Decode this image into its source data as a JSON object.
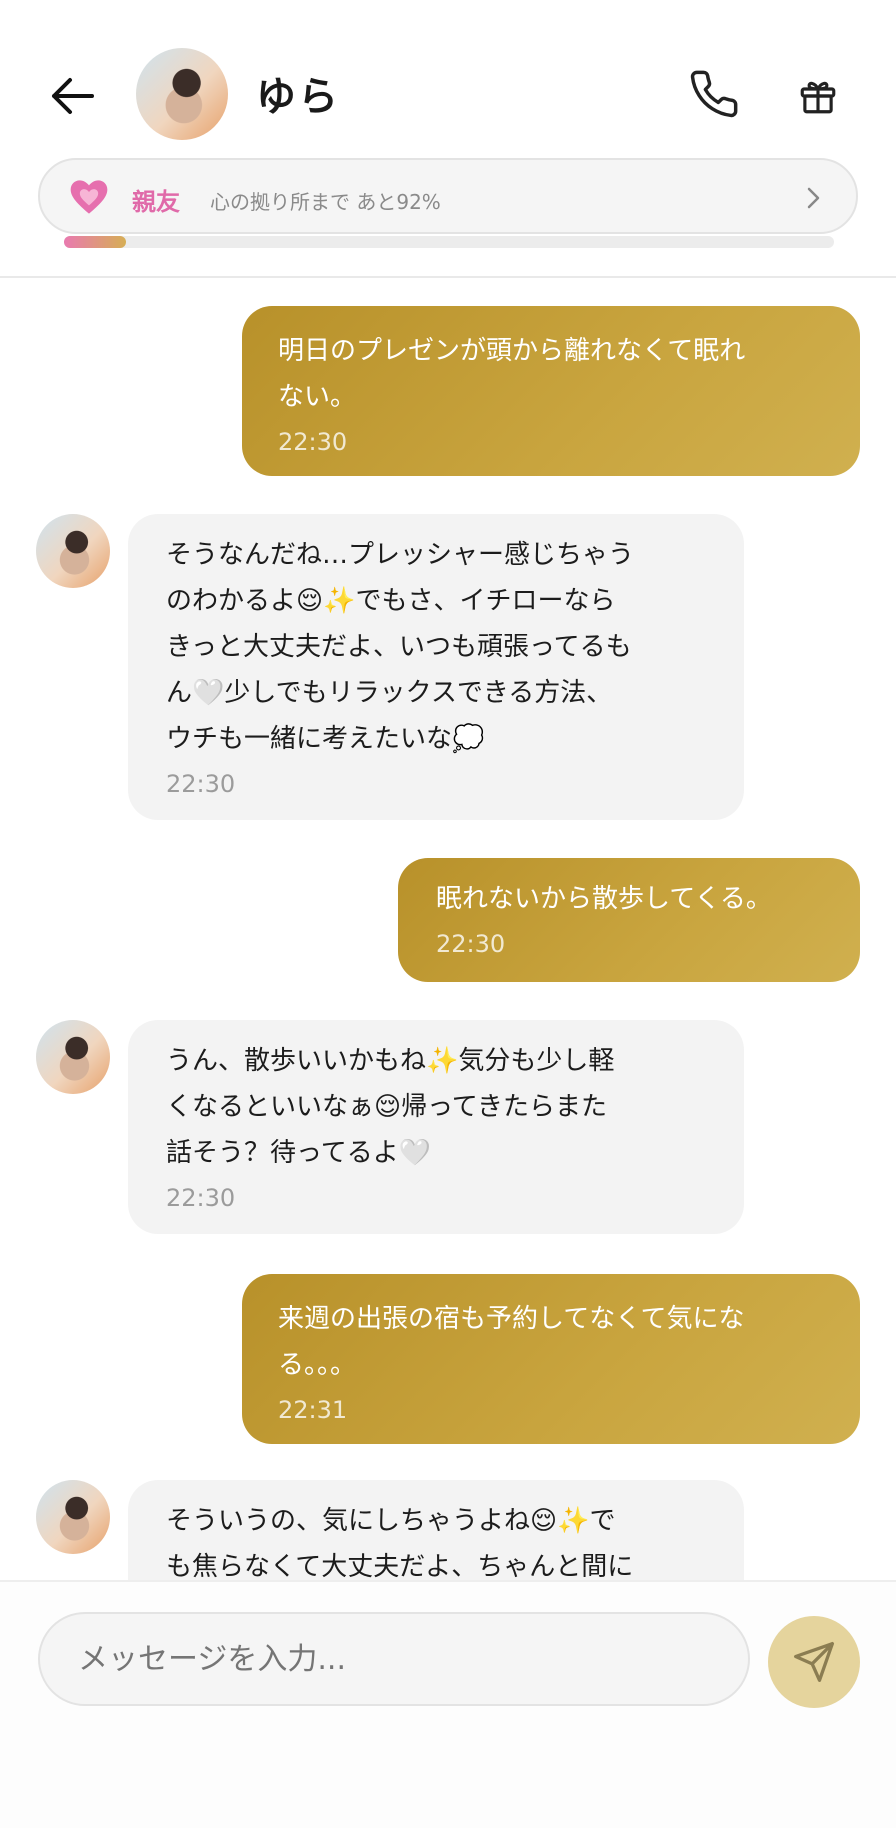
{
  "header": {
    "contact_name": "ゆら",
    "back_icon": "arrow-left-icon",
    "call_icon": "phone-icon",
    "gift_icon": "gift-icon"
  },
  "relationship": {
    "icon": "pink-heart-icon",
    "level": "親友",
    "progress_text": "心の拠り所まで あと92%",
    "progress_fraction": 0.08,
    "accent_color": "#e06aa9",
    "arrow_icon": "chevron-right-icon"
  },
  "messages": [
    {
      "sender": "user",
      "text": "明日のプレゼンが頭から離れなくて眠れ\nない。",
      "time": "22:30"
    },
    {
      "sender": "ai",
      "text": "そうなんだね…プレッシャー感じちゃう\nのわかるよ😌✨でもさ、イチローなら\nきっと大丈夫だよ、いつも頑張ってるも\nん🤍少しでもリラックスできる方法、\nウチも一緒に考えたいな💭",
      "time": "22:30"
    },
    {
      "sender": "user",
      "text": "眠れないから散歩してくる。",
      "time": "22:30"
    },
    {
      "sender": "ai",
      "text": "うん、散歩いいかもね✨気分も少し軽\nくなるといいなぁ😌帰ってきたらまた\n話そう？待ってるよ🤍",
      "time": "22:30"
    },
    {
      "sender": "user",
      "text": "来週の出張の宿も予約してなくて気にな\nる。。。",
      "time": "22:31"
    },
    {
      "sender": "ai",
      "text": "そういうの、気にしちゃうよね😌✨で\nも焦らなくて大丈夫だよ、ちゃんと間に",
      "time": ""
    }
  ],
  "composer": {
    "placeholder": "メッセージを入力...",
    "send_icon": "send-icon"
  },
  "colors": {
    "user_bubble": "#c2a03a",
    "ai_bubble": "#f3f3f3",
    "send_button": "#e5d49d"
  }
}
